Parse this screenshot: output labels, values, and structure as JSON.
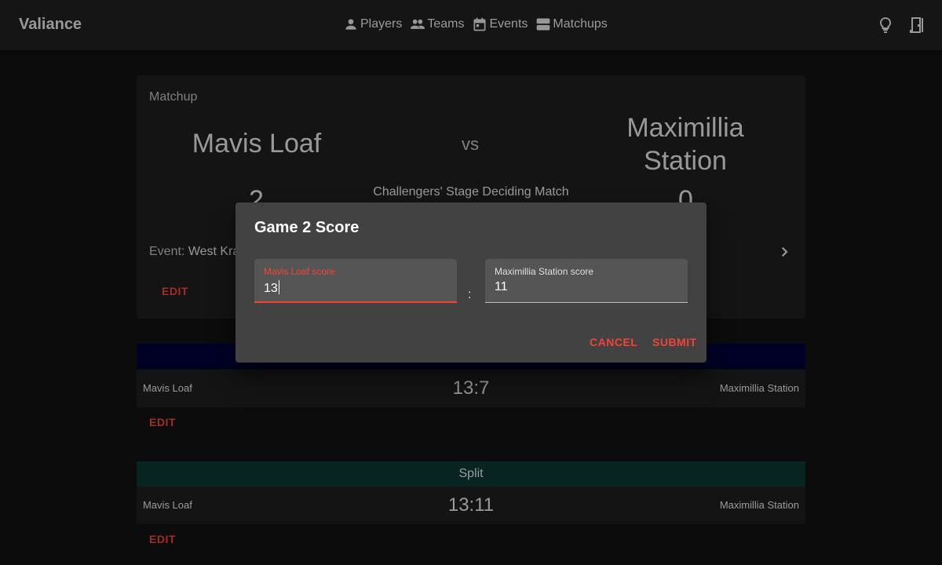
{
  "appbar": {
    "title": "Valiance",
    "nav": [
      {
        "label": "Players",
        "icon": "person-icon"
      },
      {
        "label": "Teams",
        "icon": "people-icon"
      },
      {
        "label": "Events",
        "icon": "calendar-icon"
      },
      {
        "label": "Matchups",
        "icon": "matchups-icon"
      }
    ],
    "actions": [
      {
        "icon": "lightbulb-icon"
      },
      {
        "icon": "logout-door-icon"
      }
    ]
  },
  "matchup": {
    "label": "Matchup",
    "team1": "Mavis Loaf",
    "vs": "vs",
    "team2_line1": "Maximillia",
    "team2_line2": "Station",
    "subtitle": "Challengers' Stage Deciding Match",
    "score1": "2",
    "score2": "0",
    "event_label": "Event:",
    "event_value": "West Kra",
    "edit_label": "EDIT"
  },
  "games": [
    {
      "header": "",
      "team1": "Mavis Loaf",
      "score": "13:7",
      "team2": "Maximillia Station",
      "edit_label": "EDIT",
      "header_color": "#00003a"
    },
    {
      "header": "Split",
      "team1": "Mavis Loaf",
      "score": "13:11",
      "team2": "Maximillia Station",
      "edit_label": "EDIT",
      "header_color": "#0d3532"
    }
  ],
  "dialog": {
    "title": "Game 2 Score",
    "field1_label": "Mavis Loaf score",
    "field1_value": "13",
    "separator": ":",
    "field2_label": "Maximillia Station score",
    "field2_value": "11",
    "cancel_label": "CANCEL",
    "submit_label": "SUBMIT"
  },
  "colors": {
    "accent": "#f44336",
    "background": "#121212",
    "surface": "#1e1e1e",
    "dialog": "#424242"
  }
}
